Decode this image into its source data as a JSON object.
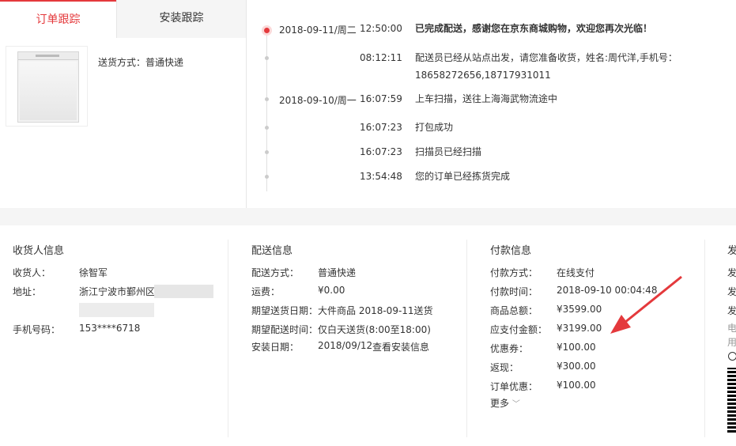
{
  "tabs": {
    "active": "订单跟踪",
    "inactive": "安装跟踪"
  },
  "product": {
    "delivery_label": "送货方式：普通快递"
  },
  "timeline": [
    {
      "date": "2018-09-11/周二",
      "time": "12:50:00",
      "text": "已完成配送，感谢您在京东商城购物，欢迎您再次光临！",
      "bold": true
    },
    {
      "date": "",
      "time": "08:12:11",
      "text": "配送员已经从站点出发，请您准备收货，姓名:周代洋,手机号：18658272656,18717931011",
      "bold": false
    },
    {
      "date": "2018-09-10/周一",
      "time": "16:07:59",
      "text": "上车扫描，送往上海海武物流途中",
      "bold": false
    },
    {
      "date": "",
      "time": "16:07:23",
      "text": "打包成功",
      "bold": false
    },
    {
      "date": "",
      "time": "16:07:23",
      "text": "扫描员已经扫描",
      "bold": false
    },
    {
      "date": "",
      "time": "13:54:48",
      "text": "您的订单已经拣货完成",
      "bold": false
    }
  ],
  "receiver": {
    "title": "收货人信息",
    "name_label": "收货人：",
    "name": "徐智军",
    "address_label": "地址：",
    "address": "浙江宁波市鄞州区",
    "phone_label": "手机号码：",
    "phone": "153****6718"
  },
  "delivery": {
    "title": "配送信息",
    "method_label": "配送方式：",
    "method": "普通快递",
    "fee_label": "运费：",
    "fee": "¥0.00",
    "expect_date_label": "期望送货日期：",
    "expect_date": "大件商品 2018-09-11送货",
    "expect_time_label": "期望配送时间：",
    "expect_time": "仅白天送货(8:00至18:00)",
    "install_label": "安装日期：",
    "install_date": "2018/09/12",
    "install_link": "查看安装信息"
  },
  "payment": {
    "title": "付款信息",
    "method_label": "付款方式：",
    "method": "在线支付",
    "time_label": "付款时间：",
    "time": "2018-09-10 00:04:48",
    "total_label": "商品总额：",
    "total": "¥3599.00",
    "payable_label": "应支付金额：",
    "payable": "¥3199.00",
    "coupon_label": "优惠券：",
    "coupon": "¥100.00",
    "cashback_label": "返现：",
    "cashback": "¥300.00",
    "order_discount_label": "订单优惠：",
    "order_discount": "¥100.00",
    "more_label": "更多"
  },
  "invoice_peek": {
    "title_char": "发",
    "row1": "发",
    "row2": "发",
    "row3": "发",
    "row4": "电",
    "row5": "用"
  },
  "colors": {
    "accent": "#e4393c",
    "divider": "#e6e6e6",
    "band": "#f5f5f5"
  }
}
